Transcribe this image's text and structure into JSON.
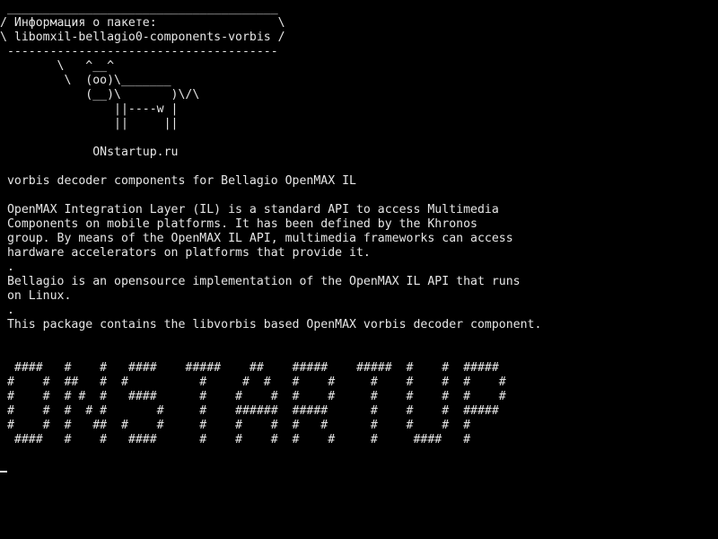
{
  "terminal": {
    "lines": [
      " ______________________________________",
      "/ Информация о пакете:                 \\",
      "\\ libomxil-bellagio0-components-vorbis /",
      " --------------------------------------",
      "        \\   ^__^",
      "         \\  (oo)\\_______",
      "            (__)\\       )\\/\\",
      "                ||----w |",
      "                ||     ||",
      "",
      "             ONstartup.ru",
      "",
      " vorbis decoder components for Bellagio OpenMAX IL",
      "",
      " OpenMAX Integration Layer (IL) is a standard API to access Multimedia",
      " Components on mobile platforms. It has been defined by the Khronos",
      " group. By means of the OpenMAX IL API, multimedia frameworks can access",
      " hardware accelerators on platforms that provide it.",
      " .",
      " Bellagio is an opensource implementation of the OpenMAX IL API that runs",
      " on Linux.",
      " .",
      " This package contains the libvorbis based OpenMAX vorbis decoder component.",
      "",
      "",
      "  ####   #    #   ####    #####    ##    #####    #####  #    #  #####",
      " #    #  ##   #  #          #     #  #   #    #     #    #    #  #    #",
      " #    #  # #  #   ####      #    #    #  #    #     #    #    #  #    #",
      " #    #  #  # #       #     #    ######  #####      #    #    #  #####",
      " #    #  #   ##  #    #     #    #    #  #   #      #    #    #  #",
      "  ####   #    #   ####      #    #    #  #    #     #     ####   #"
    ],
    "cursor": "_"
  }
}
